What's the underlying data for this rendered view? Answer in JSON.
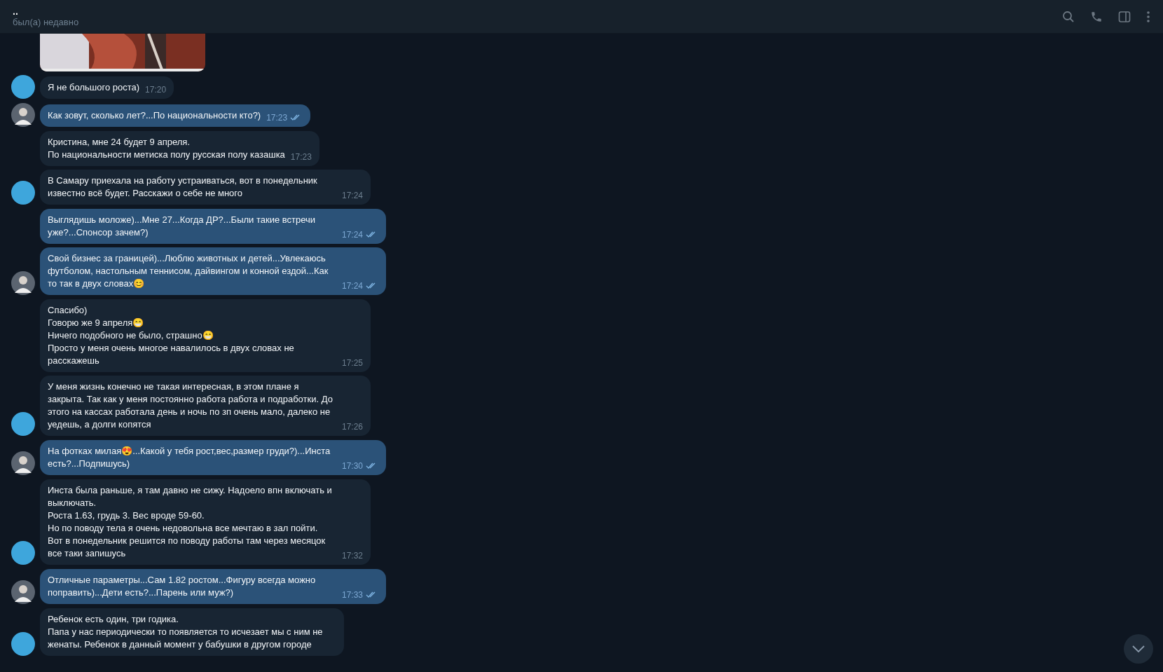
{
  "header": {
    "title": "..",
    "status": "был(а) недавно"
  },
  "messages": [
    {
      "kind": "incoming",
      "avatar": true,
      "lines": [
        "Я не большого роста)"
      ],
      "time": "17:20"
    },
    {
      "kind": "outgoing",
      "avatar": true,
      "read": true,
      "lines": [
        "Как зовут, сколько лет?...По национальности кто?)"
      ],
      "time": "17:23"
    },
    {
      "kind": "incoming",
      "avatar": false,
      "lines": [
        "Кристина, мне 24 будет 9 апреля.",
        "По национальности метиска полу русская полу казашка"
      ],
      "time": "17:23"
    },
    {
      "kind": "incoming",
      "avatar": true,
      "lines": [
        "В Самару приехала на работу устраиваться, вот в понедельник известно всё будет. Расскажи о себе не много"
      ],
      "time": "17:24"
    },
    {
      "kind": "outgoing",
      "avatar": false,
      "read": true,
      "lines": [
        "Выглядишь моложе)...Мне 27...Когда ДР?...Были такие встречи уже?...Спонсор зачем?)"
      ],
      "time": "17:24"
    },
    {
      "kind": "outgoing",
      "avatar": true,
      "read": true,
      "lines": [
        "Свой бизнес за границей)...Люблю животных и детей...Увлекаюсь футболом, настольным теннисом, дайвингом и конной ездой...Как то так в двух словах😊"
      ],
      "time": "17:24"
    },
    {
      "kind": "incoming",
      "avatar": false,
      "lines": [
        "Спасибо)",
        "Говорю же 9 апреля😁",
        "Ничего подобного не было, страшно😁",
        "Просто у меня очень многое навалилось в двух словах не расскажешь"
      ],
      "time": "17:25"
    },
    {
      "kind": "incoming",
      "avatar": true,
      "lines": [
        "У меня жизнь конечно не такая интересная, в этом плане я закрыта. Так как у меня постоянно работа работа и подработки. До этого на кассах работала день и ночь по зп очень мало, далеко не уедешь, а долги копятся"
      ],
      "time": "17:26"
    },
    {
      "kind": "outgoing",
      "avatar": true,
      "read": true,
      "lines": [
        "На фотках милая😍...Какой у тебя рост,вес,размер груди?)...Инста есть?...Подпишусь)"
      ],
      "time": "17:30"
    },
    {
      "kind": "incoming",
      "avatar": true,
      "lines": [
        "Инста была раньше, я там давно не сижу. Надоело впн включать и выключать.",
        "Роста 1.63, грудь 3. Вес вроде 59-60.",
        "Но по поводу тела я очень недовольна все мечтаю в зал пойти.",
        "Вот в понедельник решится по поводу работы там через месяцок все таки запишусь"
      ],
      "time": "17:32"
    },
    {
      "kind": "outgoing",
      "avatar": true,
      "read": true,
      "lines": [
        "Отличные параметры...Сам 1.82 ростом...Фигуру всегда можно поправить)...Дети есть?...Парень или муж?)"
      ],
      "time": "17:33"
    },
    {
      "kind": "incoming",
      "avatar": true,
      "lines": [
        "Ребенок есть один, три годика.",
        "Папа у нас периодически то появляется то исчезает мы с ним не женаты. Ребенок в данный момент у бабушки в другом городе"
      ]
    }
  ]
}
